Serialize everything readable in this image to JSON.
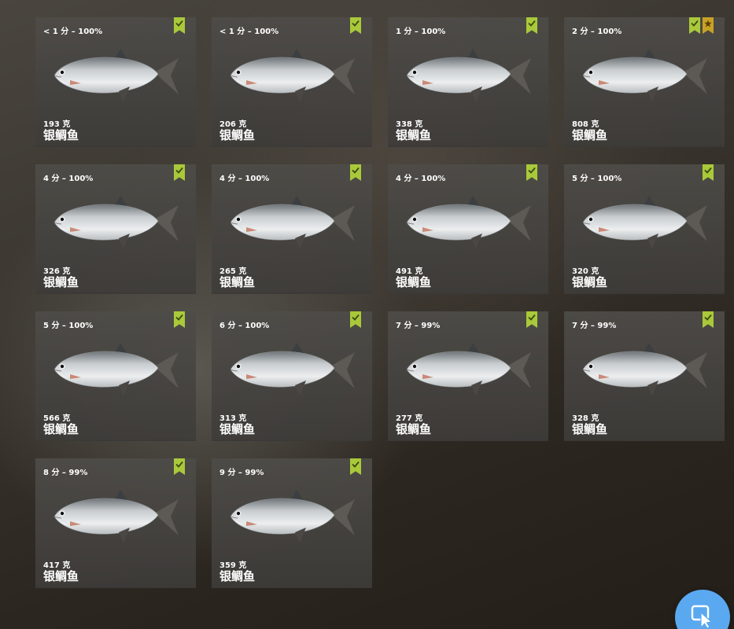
{
  "catches": [
    {
      "time": "< 1 分 – 100%",
      "weight": "193 克",
      "name": "银鲷鱼",
      "star": false
    },
    {
      "time": "< 1 分 – 100%",
      "weight": "206 克",
      "name": "银鲷鱼",
      "star": false
    },
    {
      "time": "1 分 – 100%",
      "weight": "338 克",
      "name": "银鲷鱼",
      "star": false
    },
    {
      "time": "2 分 – 100%",
      "weight": "808 克",
      "name": "银鲷鱼",
      "star": true
    },
    {
      "time": "4 分 – 100%",
      "weight": "326 克",
      "name": "银鲷鱼",
      "star": false
    },
    {
      "time": "4 分 – 100%",
      "weight": "265 克",
      "name": "银鲷鱼",
      "star": false
    },
    {
      "time": "4 分 – 100%",
      "weight": "491 克",
      "name": "银鲷鱼",
      "star": false
    },
    {
      "time": "5 分 – 100%",
      "weight": "320 克",
      "name": "银鲷鱼",
      "star": false
    },
    {
      "time": "5 分 – 100%",
      "weight": "566 克",
      "name": "银鲷鱼",
      "star": false
    },
    {
      "time": "6 分 – 100%",
      "weight": "313 克",
      "name": "银鲷鱼",
      "star": false
    },
    {
      "time": "7 分 – 99%",
      "weight": "277 克",
      "name": "银鲷鱼",
      "star": false
    },
    {
      "time": "7 分 – 99%",
      "weight": "328 克",
      "name": "银鲷鱼",
      "star": false
    },
    {
      "time": "8 分 – 99%",
      "weight": "417 克",
      "name": "银鲷鱼",
      "star": false
    },
    {
      "time": "9 分 – 99%",
      "weight": "359 克",
      "name": "银鲷鱼",
      "star": false
    }
  ],
  "icons": {
    "card_image": "fish-icon",
    "check_badge": "check-badge-icon",
    "star_badge": "star-badge-icon",
    "corner_button": "cursor-icon"
  },
  "colors": {
    "check_badge": "#a9c93a",
    "star_badge": "#c8a224",
    "corner_button": "#5aa9f0"
  }
}
